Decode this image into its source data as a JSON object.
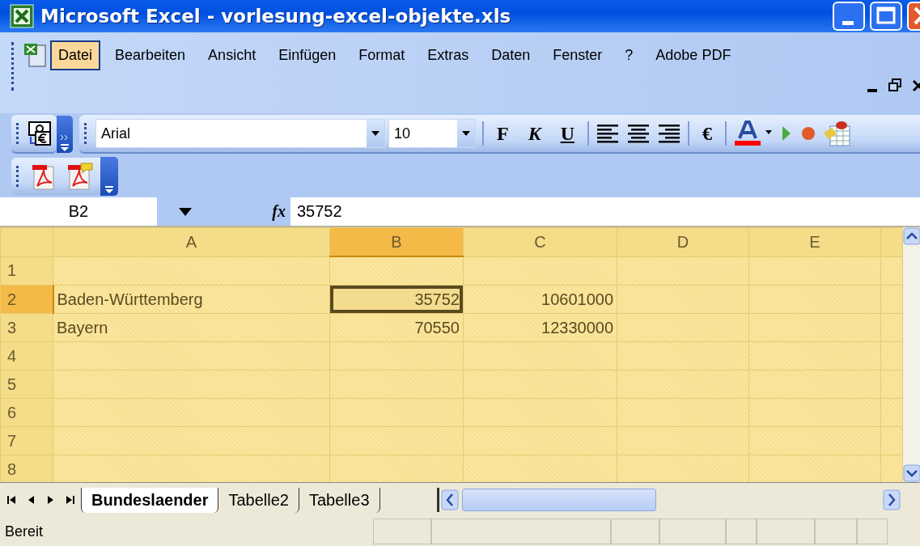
{
  "window": {
    "title": "Microsoft Excel - vorlesung-excel-objekte.xls"
  },
  "menu": [
    {
      "label": "Datei",
      "selected": true
    },
    {
      "label": "Bearbeiten",
      "selected": false
    },
    {
      "label": "Ansicht",
      "selected": false
    },
    {
      "label": "Einfügen",
      "selected": false
    },
    {
      "label": "Format",
      "selected": false
    },
    {
      "label": "Extras",
      "selected": false
    },
    {
      "label": "Daten",
      "selected": false
    },
    {
      "label": "Fenster",
      "selected": false
    },
    {
      "label": "?",
      "selected": false
    },
    {
      "label": "Adobe PDF",
      "selected": false
    }
  ],
  "format_toolbar": {
    "font": "Arial",
    "size": "10",
    "bold": "F",
    "italic": "K",
    "underline": "U",
    "currency": "€"
  },
  "formula_bar": {
    "name_box": "B2",
    "function_label": "fx",
    "value": "35752"
  },
  "grid": {
    "columns": [
      {
        "label": "A",
        "selected": false
      },
      {
        "label": "B",
        "selected": true
      },
      {
        "label": "C",
        "selected": false
      },
      {
        "label": "D",
        "selected": false
      },
      {
        "label": "E",
        "selected": false
      }
    ],
    "rows": [
      {
        "label": "1",
        "selected": false,
        "cells": []
      },
      {
        "label": "2",
        "selected": true,
        "cells": [
          {
            "text": "Baden-Württemberg",
            "kind": "text",
            "active": false
          },
          {
            "text": "35752",
            "kind": "number",
            "active": true
          },
          {
            "text": "10601000",
            "kind": "number",
            "active": false
          }
        ]
      },
      {
        "label": "3",
        "selected": false,
        "cells": [
          {
            "text": "Bayern",
            "kind": "text",
            "active": false
          },
          {
            "text": "70550",
            "kind": "number",
            "active": false
          },
          {
            "text": "12330000",
            "kind": "number",
            "active": false
          }
        ]
      },
      {
        "label": "4",
        "selected": false,
        "cells": []
      },
      {
        "label": "5",
        "selected": false,
        "cells": []
      },
      {
        "label": "6",
        "selected": false,
        "cells": []
      },
      {
        "label": "7",
        "selected": false,
        "cells": []
      },
      {
        "label": "8",
        "selected": false,
        "cells": []
      }
    ]
  },
  "sheet_tabs": [
    {
      "label": "Bundeslaender",
      "selected": true
    },
    {
      "label": "Tabelle2",
      "selected": false
    },
    {
      "label": "Tabelle3",
      "selected": false
    }
  ],
  "status_bar": {
    "text": "Bereit"
  }
}
